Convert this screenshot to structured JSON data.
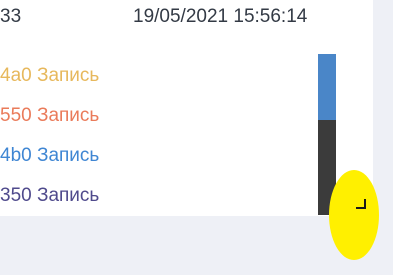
{
  "header": {
    "record_id": "33",
    "timestamp": "19/05/2021 15:56:14"
  },
  "records": [
    {
      "text": "4a0 Запись",
      "color": "#e7b85c"
    },
    {
      "text": "550 Запись",
      "color": "#ea7b5a"
    },
    {
      "text": "4b0 Запись",
      "color": "#3f86d3"
    },
    {
      "text": "350 Запись",
      "color": "#4f4a8c"
    }
  ],
  "scrollbar": {
    "thumb_fraction": 0.41
  },
  "colors": {
    "text": "#333a45",
    "scrollbar_track": "#3b3b3b",
    "scrollbar_thumb": "#4a86c8",
    "highlight": "#fff000"
  }
}
